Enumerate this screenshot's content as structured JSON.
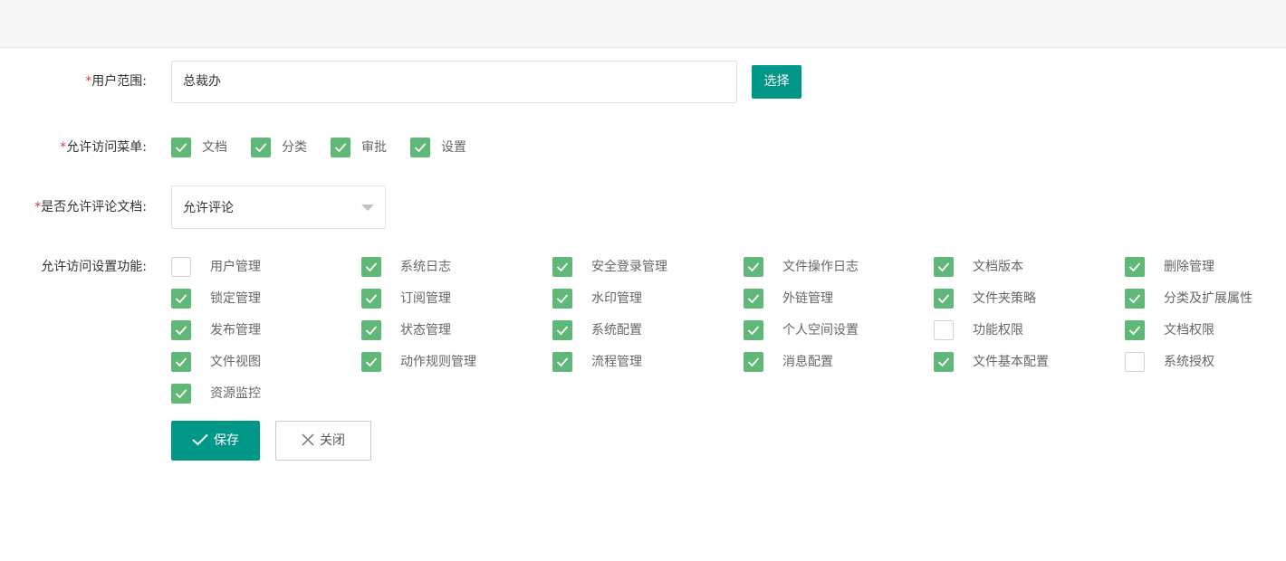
{
  "form": {
    "user_scope": {
      "required_mark": "*",
      "label": "用户范围:",
      "value": "总裁办",
      "select_button": "选择"
    },
    "menus": {
      "required_mark": "*",
      "label": "允许访问菜单:",
      "options": [
        {
          "label": "文档",
          "checked": true
        },
        {
          "label": "分类",
          "checked": true
        },
        {
          "label": "审批",
          "checked": true
        },
        {
          "label": "设置",
          "checked": true
        }
      ]
    },
    "comment": {
      "required_mark": "*",
      "label": "是否允许评论文档:",
      "selected": "允许评论"
    },
    "settings": {
      "label": "允许访问设置功能:",
      "options": [
        {
          "label": "用户管理",
          "checked": false
        },
        {
          "label": "系统日志",
          "checked": true
        },
        {
          "label": "安全登录管理",
          "checked": true
        },
        {
          "label": "文件操作日志",
          "checked": true
        },
        {
          "label": "文档版本",
          "checked": true
        },
        {
          "label": "删除管理",
          "checked": true
        },
        {
          "label": "锁定管理",
          "checked": true
        },
        {
          "label": "订阅管理",
          "checked": true
        },
        {
          "label": "水印管理",
          "checked": true
        },
        {
          "label": "外链管理",
          "checked": true
        },
        {
          "label": "文件夹策略",
          "checked": true
        },
        {
          "label": "分类及扩展属性",
          "checked": true
        },
        {
          "label": "发布管理",
          "checked": true
        },
        {
          "label": "状态管理",
          "checked": true
        },
        {
          "label": "系统配置",
          "checked": true
        },
        {
          "label": "个人空间设置",
          "checked": true
        },
        {
          "label": "功能权限",
          "checked": false
        },
        {
          "label": "文档权限",
          "checked": true
        },
        {
          "label": "文件视图",
          "checked": true
        },
        {
          "label": "动作规则管理",
          "checked": true
        },
        {
          "label": "流程管理",
          "checked": true
        },
        {
          "label": "消息配置",
          "checked": true
        },
        {
          "label": "文件基本配置",
          "checked": true
        },
        {
          "label": "系统授权",
          "checked": false
        },
        {
          "label": "资源监控",
          "checked": true
        }
      ]
    }
  },
  "actions": {
    "save_label": "保存",
    "close_label": "关闭"
  },
  "colors": {
    "primary": "#009688",
    "checkbox_checked": "#5fb878",
    "required": "#e4393c"
  }
}
